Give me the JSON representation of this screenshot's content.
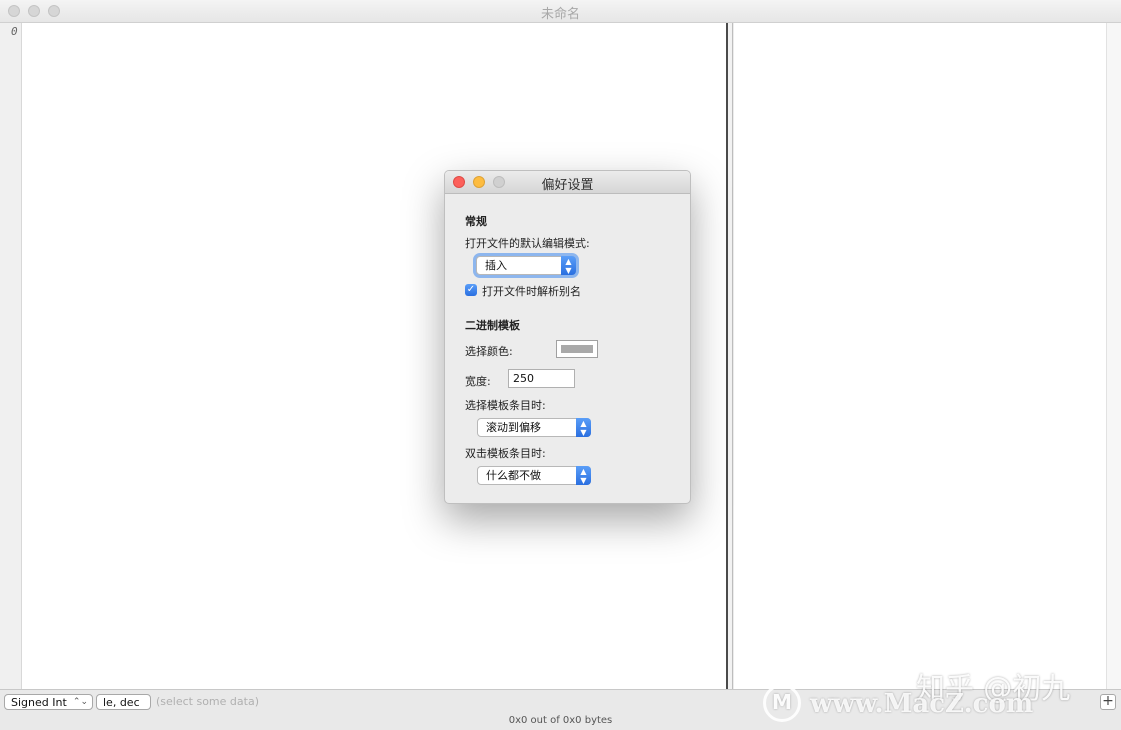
{
  "window": {
    "title": "未命名"
  },
  "gutter": {
    "offset_label": "0"
  },
  "statusbar": {
    "type_select": "Signed Int",
    "endian_select": "le, dec",
    "hint": "(select some data)",
    "byte_count": "0x0 out of 0x0 bytes",
    "plus_label": "+"
  },
  "preferences": {
    "title": "偏好设置",
    "general": {
      "heading": "常规",
      "default_mode_label": "打开文件的默认编辑模式:",
      "default_mode_value": "插入",
      "resolve_aliases_label": "打开文件时解析别名",
      "resolve_aliases_checked": true
    },
    "binary_template": {
      "heading": "二进制模板",
      "selection_color_label": "选择颜色:",
      "selection_color": "#a9a9a9",
      "width_label": "宽度:",
      "width_value": "250",
      "on_select_label": "选择模板条目时:",
      "on_select_value": "滚动到偏移",
      "on_double_click_label": "双击模板条目时:",
      "on_double_click_value": "什么都不做"
    }
  },
  "colors": {
    "accent": "#2a6fe0",
    "close": "#fc605b",
    "minimize": "#fdbc40",
    "zoom_disabled": "#d0d0d0"
  },
  "watermark": {
    "text": "知乎 @初九",
    "url": "www.MacZ.com",
    "logo_letter": "M"
  }
}
